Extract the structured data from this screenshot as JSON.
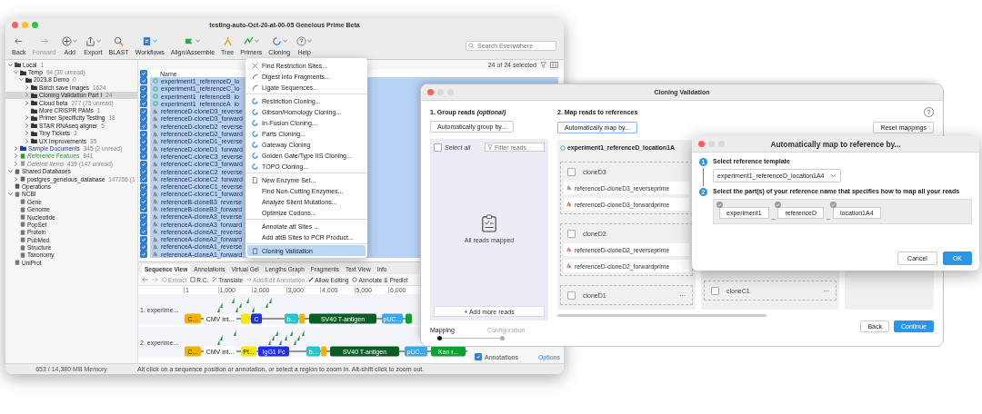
{
  "main_window": {
    "title": "testing-auto-Oct-20-at-00-05 Geneious Prime Beta",
    "toolbar": [
      {
        "label": "Back",
        "kind": "back",
        "dropdown": false,
        "disabled": false
      },
      {
        "label": "Forward",
        "kind": "forward",
        "dropdown": false,
        "disabled": true
      },
      {
        "label": "Add",
        "kind": "add",
        "dropdown": true,
        "disabled": false
      },
      {
        "label": "Export",
        "kind": "export",
        "dropdown": true,
        "disabled": false
      },
      {
        "label": "BLAST",
        "kind": "blast",
        "dropdown": false,
        "disabled": false
      },
      {
        "label": "Workflows",
        "kind": "workflow",
        "dropdown": true,
        "disabled": false
      },
      {
        "label": "Align/Assemble",
        "kind": "align",
        "dropdown": true,
        "disabled": false
      },
      {
        "label": "Tree",
        "kind": "tree",
        "dropdown": false,
        "disabled": false
      },
      {
        "label": "Primers",
        "kind": "primers",
        "dropdown": true,
        "disabled": false
      },
      {
        "label": "Cloning",
        "kind": "cloning",
        "dropdown": true,
        "disabled": false
      },
      {
        "label": "Help",
        "kind": "help",
        "dropdown": true,
        "disabled": false
      }
    ],
    "search": {
      "placeholder": "Search Everywhere"
    },
    "sidebar": [
      {
        "label": "Local",
        "count": "1",
        "kind": "drive",
        "expanded": true,
        "selected": false,
        "children": [
          {
            "label": "Temp",
            "count": "94 (30 unread)",
            "kind": "folder",
            "expanded": true,
            "selected": false,
            "children": [
              {
                "label": "2023.8 Demo",
                "count": "0",
                "kind": "folder",
                "expanded": true,
                "selected": false,
                "children": [
                  {
                    "label": "Batch save images",
                    "count": "1624",
                    "kind": "folder",
                    "expanded": false,
                    "selected": false
                  },
                  {
                    "label": "Cloning Validation Part I",
                    "count": "24",
                    "kind": "folder",
                    "expanded": false,
                    "selected": true
                  },
                  {
                    "label": "Cloud beta",
                    "count": "277 (75 unread)",
                    "kind": "folder",
                    "expanded": false,
                    "selected": false
                  },
                  {
                    "label": "More CRISPR PAMs",
                    "count": "1",
                    "kind": "folder",
                    "selected": false
                  },
                  {
                    "label": "Primer Specificity Testing",
                    "count": "18",
                    "kind": "folder",
                    "expanded": false,
                    "selected": false
                  },
                  {
                    "label": "STAR RNAseq aligner",
                    "count": "5",
                    "kind": "folder",
                    "expanded": false,
                    "selected": false
                  },
                  {
                    "label": "Tiny Tickets",
                    "count": "3",
                    "kind": "folder",
                    "expanded": false,
                    "selected": false
                  },
                  {
                    "label": "UX Improvements",
                    "count": "35",
                    "kind": "folder",
                    "expanded": false,
                    "selected": false
                  }
                ]
              }
            ]
          },
          {
            "label": "Sample Documents",
            "count": "345 (2 unread)",
            "kind": "samples",
            "expanded": false,
            "selected": false
          },
          {
            "label": "Reference Features",
            "count": "841",
            "kind": "reference",
            "expanded": false,
            "selected": false
          },
          {
            "label": "Deleted Items",
            "count": "439 (147 unread)",
            "kind": "trash",
            "expanded": false,
            "selected": false
          }
        ]
      },
      {
        "label": "Shared Databases",
        "kind": "database",
        "expanded": true,
        "selected": false,
        "children": [
          {
            "label": "postgres_geneious_database",
            "count": "147256 (1",
            "kind": "database",
            "expanded": false,
            "selected": false
          }
        ]
      },
      {
        "label": "Operations",
        "kind": "operations",
        "selected": false
      },
      {
        "label": "NCBI",
        "kind": "ncbi",
        "expanded": true,
        "selected": false,
        "children": [
          {
            "label": "Gene",
            "kind": "db",
            "selected": false
          },
          {
            "label": "Genome",
            "kind": "db",
            "selected": false
          },
          {
            "label": "Nucleotide",
            "kind": "db",
            "selected": false
          },
          {
            "label": "PopSet",
            "kind": "db",
            "selected": false
          },
          {
            "label": "Protein",
            "kind": "db",
            "selected": false
          },
          {
            "label": "PubMed",
            "kind": "db",
            "selected": false
          },
          {
            "label": "Structure",
            "kind": "db",
            "selected": false
          },
          {
            "label": "Taxonomy",
            "kind": "db",
            "selected": false
          }
        ]
      },
      {
        "label": "UniProt",
        "kind": "db",
        "selected": false
      }
    ],
    "selection_count": "24 of 24 selected",
    "list": {
      "header_checked": true,
      "column": "Name",
      "rows": [
        {
          "name": "experiment1_referenceD_lo",
          "kind": "sequence",
          "checked": true,
          "selected": true
        },
        {
          "name": "experiment1_referenceC_lo",
          "kind": "sequence",
          "checked": true,
          "selected": true
        },
        {
          "name": "experiment1_referenceB_lo",
          "kind": "sequence",
          "checked": true,
          "selected": true
        },
        {
          "name": "experiment1_referenceA_lo",
          "kind": "sequence",
          "checked": true,
          "selected": true
        },
        {
          "name": "referenceD-cloneD3_reverse",
          "kind": "read",
          "checked": true,
          "selected": true
        },
        {
          "name": "referenceD-cloneD3_forward",
          "kind": "read",
          "checked": true,
          "selected": true
        },
        {
          "name": "referenceD-cloneD2_reverse",
          "kind": "read",
          "checked": true,
          "selected": true
        },
        {
          "name": "referenceD-cloneD2_forward",
          "kind": "read",
          "checked": true,
          "selected": true
        },
        {
          "name": "referenceD-cloneD1_reverse",
          "kind": "read",
          "checked": true,
          "selected": true
        },
        {
          "name": "referenceD-cloneD1_forward",
          "kind": "read",
          "checked": true,
          "selected": true
        },
        {
          "name": "referenceC-cloneC3_reverse",
          "kind": "read",
          "checked": true,
          "selected": true
        },
        {
          "name": "referenceC-cloneC3_forward",
          "kind": "read",
          "checked": true,
          "selected": true
        },
        {
          "name": "referenceC-cloneC2_reverse",
          "kind": "read",
          "checked": true,
          "selected": true
        },
        {
          "name": "referenceC-cloneC2_forward",
          "kind": "read",
          "checked": true,
          "selected": true
        },
        {
          "name": "referenceC-cloneC1_reverse",
          "kind": "read",
          "checked": true,
          "selected": true
        },
        {
          "name": "referenceC-cloneC1_forward",
          "kind": "read",
          "checked": true,
          "selected": true
        },
        {
          "name": "referenceB-cloneB3_reverse",
          "kind": "read",
          "checked": true,
          "selected": true
        },
        {
          "name": "referenceB-cloneB3_forward",
          "kind": "read",
          "checked": true,
          "selected": true
        },
        {
          "name": "referenceA-cloneA3_reverse",
          "kind": "read",
          "checked": true,
          "selected": true
        },
        {
          "name": "referenceA-cloneA3_forward",
          "kind": "read",
          "checked": true,
          "selected": true
        },
        {
          "name": "referenceA-cloneA2_reverse",
          "kind": "read",
          "checked": true,
          "selected": true
        },
        {
          "name": "referenceA-cloneA2_forward",
          "kind": "read",
          "checked": true,
          "selected": true
        },
        {
          "name": "referenceA-cloneA1_reverse",
          "kind": "read",
          "checked": true,
          "selected": true
        },
        {
          "name": "referenceA-cloneA1_forward",
          "kind": "read",
          "checked": true,
          "selected": true
        }
      ]
    },
    "viewer_tabs": [
      {
        "label": "Sequence View",
        "selected": true
      },
      {
        "label": "Annotations",
        "selected": false
      },
      {
        "label": "Virtual Gel",
        "selected": false
      },
      {
        "label": "Lengths Graph",
        "selected": false
      },
      {
        "label": "Fragments",
        "selected": false
      },
      {
        "label": "Text View",
        "selected": false
      },
      {
        "label": "Info",
        "selected": false
      }
    ],
    "viewer_tools": [
      {
        "label": "Extract",
        "kind": "extract",
        "disabled": true
      },
      {
        "label": "R.C.",
        "kind": "rc",
        "disabled": false
      },
      {
        "label": "Translate",
        "kind": "translate",
        "disabled": false
      },
      {
        "label": "Add/Edit Annotation",
        "kind": "annotation",
        "disabled": true
      },
      {
        "label": "Allow Editing",
        "kind": "edit",
        "disabled": false
      },
      {
        "label": "Annotate & Predict",
        "kind": "predict",
        "disabled": false
      }
    ],
    "ruler": [
      "1",
      "1,000",
      "2,000",
      "3,000",
      "4,000",
      "5,000",
      "6,000"
    ],
    "tracks": [
      {
        "name": "1. experime...",
        "features": [
          {
            "label": "C...",
            "color": "#f0b400"
          },
          {
            "label": "CMV int...",
            "color": "#ffffff"
          },
          {
            "color": "#f5e900"
          },
          {
            "label": "C",
            "color": "#2030e0"
          },
          {
            "label": "b...",
            "color": "#20c8d0"
          },
          {
            "color": "#f0b400"
          },
          {
            "label": "SV40 T-antigen",
            "color": "#0b5e23"
          },
          {
            "label": "pUC...",
            "color": "#3aa8f0"
          },
          {
            "color": "#10a030"
          }
        ]
      },
      {
        "name": "2. experime...",
        "features": [
          {
            "label": "C...",
            "color": "#f0b400"
          },
          {
            "label": "CMV int...",
            "color": "#ffffff"
          },
          {
            "label": "Pt...",
            "color": "#f5e900"
          },
          {
            "label": "IgG1 Fc",
            "color": "#2030e0"
          },
          {
            "label": "b...",
            "color": "#20c8d0"
          },
          {
            "color": "#f0b400"
          },
          {
            "label": "SV40 T-antigen",
            "color": "#0b5e23"
          },
          {
            "label": "pUC...",
            "color": "#3aa8f0"
          },
          {
            "label": "Kan r...",
            "color": "#10a030"
          }
        ]
      }
    ],
    "side_panel": {
      "annotations_label": "Annotations",
      "annotations_checked": true,
      "options_link": "Options"
    },
    "memory": "653 / 14,380 MB Memory",
    "status_hint": "Alt click on a sequence position or annotation, or select a region to zoom in. Alt-shift click to zoom out."
  },
  "cloning_menu": {
    "groups": [
      [
        {
          "label": "Find Restriction Sites...",
          "kind": "scissors",
          "selected": false
        },
        {
          "label": "Digest Into Fragments...",
          "kind": "curve",
          "selected": false
        },
        {
          "label": "Ligate Sequences...",
          "kind": "curve",
          "selected": false
        }
      ],
      [
        {
          "label": "Restriction Cloning...",
          "kind": "ring",
          "selected": false
        },
        {
          "label": "Gibson/Homology Cloning...",
          "kind": "ring",
          "selected": false
        },
        {
          "label": "In-Fusion Cloning...",
          "kind": "ring",
          "selected": false
        },
        {
          "label": "Parts Cloning...",
          "kind": "ring",
          "selected": false
        },
        {
          "label": "Gateway Cloning",
          "kind": "ring",
          "selected": false
        },
        {
          "label": "Golden Gate/Type IIS Cloning...",
          "kind": "ring",
          "selected": false
        },
        {
          "label": "TOPO Cloning...",
          "kind": "ring",
          "selected": false
        }
      ],
      [
        {
          "label": "New Enzyme Set...",
          "kind": "page",
          "selected": false
        },
        {
          "label": "Find Non-Cutting Enzymes...",
          "selected": false
        },
        {
          "label": "Analyze Silent Mutations...",
          "selected": false
        },
        {
          "label": "Optimize Codons...",
          "selected": false
        }
      ],
      [
        {
          "label": "Annotate att Sites ...",
          "selected": false
        },
        {
          "label": "Add attB Sites to PCR Product...",
          "selected": false
        }
      ],
      [
        {
          "label": "Cloning Validation",
          "kind": "clipboard",
          "selected": true
        }
      ]
    ]
  },
  "cloning_window": {
    "title": "Cloning Validation",
    "group_heading": "1. Group reads *(optional)*",
    "group_button": "Automatically group by...",
    "map_heading": "2. Map reads to references",
    "map_button": "Automatically map by...",
    "reset_button": "Reset mappings",
    "help": "?",
    "select_all": {
      "label": "Select all",
      "checked": false
    },
    "filter": {
      "placeholder": "Filter reads"
    },
    "empty_message": "All reads mapped",
    "add_button": "+ Add more reads",
    "references": [
      {
        "name": "experiment1_referenceD_location1A",
        "groups": [
          {
            "name": "cloneD3",
            "checked": false,
            "reads": [
              "referenceD-cloneD3_reverseprime",
              "referenceD-cloneD3_forwardprime"
            ]
          },
          {
            "name": "cloneD2",
            "checked": false,
            "reads": [
              "referenceD-cloneD2_reverseprime",
              "referenceD-cloneD2_forwardprime"
            ]
          },
          {
            "name": "cloneD1",
            "checked": false,
            "more": "···"
          }
        ]
      },
      {
        "groups": [
          {
            "name": "cloneC1",
            "checked": false,
            "more": "···"
          }
        ]
      }
    ],
    "steps": [
      {
        "label": "Mapping",
        "selected": true
      },
      {
        "label": "Configuration",
        "selected": false
      }
    ],
    "back_button": "Back",
    "continue_button": "Continue"
  },
  "automap_dialog": {
    "title": "Automatically map to reference by...",
    "step1": {
      "number": "1",
      "label": "Select reference template",
      "value": "experiment1_referenceD_location1A4"
    },
    "step2": {
      "number": "2",
      "label": "Select the part(s) of your reference name that specifies how to map all your reads",
      "parts": [
        {
          "label": "experiment1",
          "checked": true
        },
        {
          "separator": "_",
          "label": "referenceD",
          "checked": true
        },
        {
          "separator": "_",
          "label": "location1A4",
          "checked": true
        }
      ]
    },
    "cancel_button": "Cancel",
    "ok_button": "OK"
  }
}
